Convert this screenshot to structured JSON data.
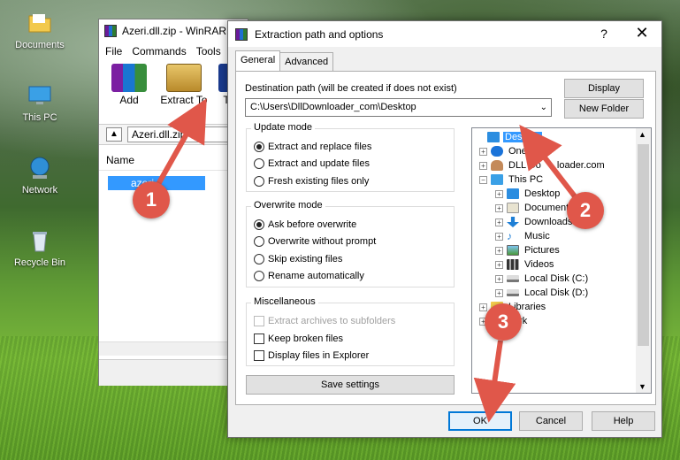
{
  "desktop": {
    "icons": [
      {
        "label": "Documents"
      },
      {
        "label": "This PC"
      },
      {
        "label": "Network"
      },
      {
        "label": "Recycle Bin"
      }
    ]
  },
  "winrar": {
    "title": "Azeri.dll.zip - WinRAR",
    "menu": [
      "File",
      "Commands",
      "Tools"
    ],
    "toolbar": {
      "add": "Add",
      "extract_to": "Extract To",
      "next": "T"
    },
    "path": "Azeri.dll.zip",
    "column_name": "Name",
    "selected_file": "azeri"
  },
  "dialog": {
    "title": "Extraction path and options",
    "help": "?",
    "close": "✕",
    "tabs": [
      "General",
      "Advanced"
    ],
    "dest_label": "Destination path (will be created if does not exist)",
    "dest_value": "C:\\Users\\DllDownloader_com\\Desktop",
    "display_btn": "Display",
    "new_folder_btn": "New Folder",
    "update_mode": {
      "title": "Update mode",
      "options": [
        "Extract and replace files",
        "Extract and update files",
        "Fresh existing files only"
      ],
      "selected": 0
    },
    "overwrite_mode": {
      "title": "Overwrite mode",
      "options": [
        "Ask before overwrite",
        "Overwrite without prompt",
        "Skip existing files",
        "Rename automatically"
      ],
      "selected": 0
    },
    "misc": {
      "title": "Miscellaneous",
      "options": [
        "Extract archives to subfolders",
        "Keep broken files",
        "Display files in Explorer"
      ]
    },
    "save_settings": "Save settings",
    "ok": "OK",
    "cancel": "Cancel",
    "help_btn": "Help",
    "tree": [
      {
        "label": "Desktop",
        "selected": true
      },
      {
        "label": "OneD"
      },
      {
        "label": "DLL Do",
        "label_tail": "loader.com"
      },
      {
        "label": "This PC"
      },
      {
        "label": "Desktop"
      },
      {
        "label": "Documents"
      },
      {
        "label": "Downloads"
      },
      {
        "label": "Music"
      },
      {
        "label": "Pictures"
      },
      {
        "label": "Videos"
      },
      {
        "label": "Local Disk (C:)"
      },
      {
        "label": "Local Disk (D:)"
      },
      {
        "label": "Libraries"
      },
      {
        "label": "ork"
      }
    ]
  },
  "annotations": {
    "step1": "1",
    "step2": "2",
    "step3": "3",
    "color": "#e0574a"
  }
}
